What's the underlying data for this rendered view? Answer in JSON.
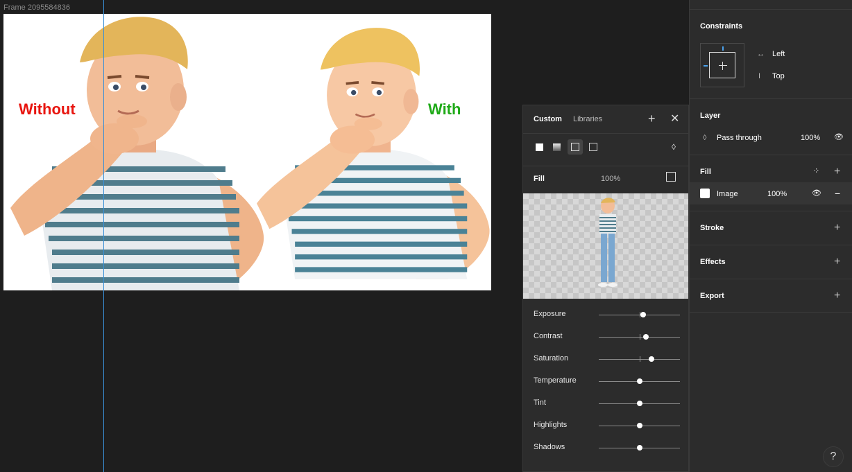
{
  "canvas": {
    "frame_label": "Frame 2095584836",
    "left_caption": "Without",
    "right_caption": "With",
    "left_caption_color": "#e8150f",
    "right_caption_color": "#1faa18"
  },
  "fill_picker": {
    "tabs": [
      "Custom",
      "Libraries"
    ],
    "fill_label": "Fill",
    "fill_opacity": "100%",
    "adjustments": [
      {
        "label": "Exposure",
        "value": 0.55
      },
      {
        "label": "Contrast",
        "value": 0.58
      },
      {
        "label": "Saturation",
        "value": 0.65
      },
      {
        "label": "Temperature",
        "value": 0.5
      },
      {
        "label": "Tint",
        "value": 0.5
      },
      {
        "label": "Highlights",
        "value": 0.5
      },
      {
        "label": "Shadows",
        "value": 0.5
      }
    ]
  },
  "properties": {
    "constraints": {
      "title": "Constraints",
      "horizontal": "Left",
      "vertical": "Top"
    },
    "layer": {
      "title": "Layer",
      "blend": "Pass through",
      "opacity": "100%"
    },
    "fill": {
      "title": "Fill",
      "item_label": "Image",
      "item_opacity": "100%"
    },
    "stroke": {
      "title": "Stroke"
    },
    "effects": {
      "title": "Effects"
    },
    "export": {
      "title": "Export"
    }
  },
  "help": {
    "label": "?"
  }
}
